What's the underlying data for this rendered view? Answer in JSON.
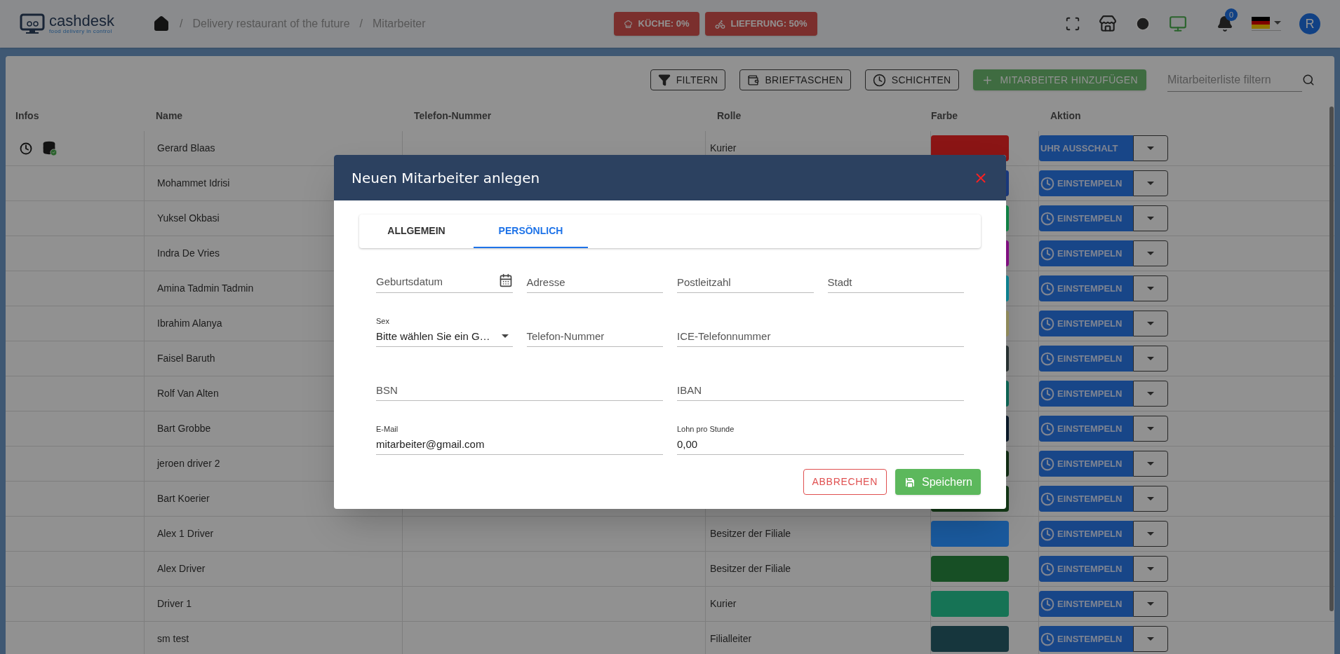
{
  "header": {
    "brand": "cashdesk",
    "tagline": "food delivery in control",
    "breadcrumbs": [
      {
        "separator": "/",
        "label": "Delivery restaurant of the future"
      },
      {
        "separator": "/",
        "label": "Mitarbeiter"
      }
    ],
    "status_badges": [
      {
        "kind": "kitchen",
        "label": "KÜCHE: 0%"
      },
      {
        "kind": "delivery",
        "label": "LIEFERUNG: 50%"
      }
    ],
    "notifications": {
      "count": "0"
    },
    "avatar": "R"
  },
  "toolbar": {
    "buttons": [
      {
        "kind": "filter",
        "label": "FILTERN"
      },
      {
        "kind": "wallet",
        "label": "BRIEFTASCHEN"
      },
      {
        "kind": "shifts",
        "label": "SCHICHTEN"
      },
      {
        "kind": "add",
        "label": "MITARBEITER HINZUFÜGEN"
      }
    ],
    "search": {
      "placeholder": "Mitarbeiterliste filtern"
    }
  },
  "table": {
    "columns": [
      "Infos",
      "Name",
      "Telefon-Nummer",
      "Rolle",
      "Farbe",
      "Aktion"
    ],
    "rows": [
      {
        "name": "Gerard Blaas",
        "role": "Kurier",
        "color": "#8b1515",
        "clocked_in": true,
        "action": "UHR AUSSCHALT"
      },
      {
        "name": "Mohammet Idrisi",
        "color": "#1a3a80",
        "clocked_in": false,
        "action": "EINSTEMPELN"
      },
      {
        "name": "Yuksel Okbasi",
        "color": "#118a4a",
        "clocked_in": false,
        "action": "EINSTEMPELN"
      },
      {
        "name": "Indra De Vries",
        "color": "#8a108a",
        "clocked_in": false,
        "action": "EINSTEMPELN"
      },
      {
        "name": "Amina Tadmin Tadmin",
        "color": "#0e8a9a",
        "clocked_in": false,
        "action": "EINSTEMPELN"
      },
      {
        "name": "Ibrahim Alanya",
        "color": "#9a9462",
        "clocked_in": false,
        "action": "EINSTEMPELN"
      },
      {
        "name": "Faisel Baruth",
        "color": "#2a3434",
        "clocked_in": false,
        "action": "EINSTEMPELN"
      },
      {
        "name": "Rolf Van Alten",
        "color": "#0e6a58",
        "clocked_in": false,
        "action": "EINSTEMPELN"
      },
      {
        "name": "Bart Grobbe",
        "color": "#0a1a2a",
        "clocked_in": false,
        "action": "EINSTEMPELN"
      },
      {
        "name": "jeroen driver 2",
        "color": "#112e14",
        "clocked_in": false,
        "action": "EINSTEMPELN"
      },
      {
        "name": "Bart Koerier",
        "color": "#133816",
        "clocked_in": false,
        "action": "EINSTEMPELN"
      },
      {
        "name": "Alex 1 Driver",
        "role": "Besitzer der Filiale",
        "color": "#1a5a9e",
        "clocked_in": false,
        "action": "EINSTEMPELN"
      },
      {
        "name": "Alex Driver",
        "role": "Besitzer der Filiale",
        "color": "#174f25",
        "clocked_in": false,
        "action": "EINSTEMPELN"
      },
      {
        "name": "Driver 1",
        "role": "Kurier",
        "color": "#167355",
        "clocked_in": false,
        "action": "EINSTEMPELN"
      },
      {
        "name": "sm test",
        "role": "Filialleiter",
        "color": "#16363d",
        "clocked_in": false,
        "action": "EINSTEMPELN"
      }
    ]
  },
  "dialog": {
    "title": "Neuen Mitarbeiter anlegen",
    "tabs": [
      {
        "label": "ALLGEMEIN",
        "selected": false
      },
      {
        "label": "PERSÖNLICH",
        "selected": true
      }
    ],
    "field_rows": [
      [
        {
          "kind": "date",
          "label": "Geburtsdatum"
        },
        {
          "kind": "text",
          "label": "Adresse"
        },
        {
          "kind": "text",
          "label": "Postleitzahl"
        },
        {
          "kind": "text",
          "label": "Stadt"
        }
      ],
      [
        {
          "kind": "select",
          "label": "Sex",
          "value": "Bitte wählen Sie ein G…"
        },
        {
          "kind": "text",
          "label": "Telefon-Nummer"
        },
        {
          "kind": "text",
          "label": "ICE-Telefonnummer"
        }
      ],
      [
        {
          "kind": "text",
          "label": "BSN"
        },
        {
          "kind": "text",
          "label": "IBAN"
        }
      ],
      [
        {
          "kind": "text",
          "label": "E-Mail",
          "value": "mitarbeiter@gmail.com"
        },
        {
          "kind": "text",
          "label": "Lohn pro Stunde",
          "value": "0,00"
        }
      ]
    ],
    "buttons": [
      {
        "kind": "cancel",
        "label": "ABBRECHEN"
      },
      {
        "kind": "save",
        "label": "Speichern"
      }
    ]
  }
}
